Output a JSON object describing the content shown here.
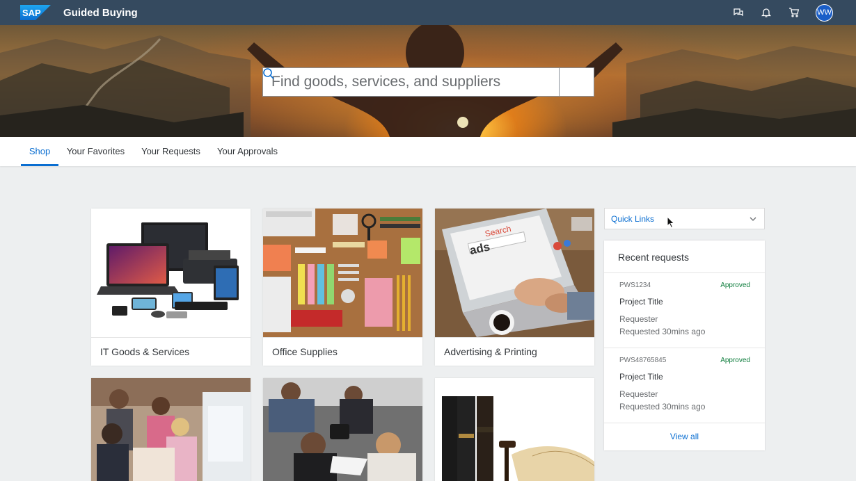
{
  "shellbar": {
    "logo_text": "SAP",
    "title": "Guided Buying",
    "avatar_initials": "WW",
    "icons": [
      "chat-icon",
      "bell-icon",
      "cart-icon"
    ]
  },
  "hero": {
    "search_placeholder": "Find goods, services, and suppliers"
  },
  "tabs": [
    {
      "label": "Shop",
      "active": true
    },
    {
      "label": "Your Favorites",
      "active": false
    },
    {
      "label": "Your Requests",
      "active": false
    },
    {
      "label": "Your Approvals",
      "active": false
    }
  ],
  "categories": [
    {
      "label": "IT Goods & Services"
    },
    {
      "label": "Office Supplies"
    },
    {
      "label": "Advertising & Printing"
    },
    {
      "label": ""
    },
    {
      "label": ""
    },
    {
      "label": ""
    }
  ],
  "advertising_image_text": {
    "search": "Search",
    "ads": "ads"
  },
  "quick_links": {
    "label": "Quick Links"
  },
  "recent_requests": {
    "title": "Recent requests",
    "items": [
      {
        "id": "PWS1234",
        "status": "Approved",
        "title": "Project Title",
        "requester": "Requester",
        "time": "Requested 30mins ago"
      },
      {
        "id": "PWS48765845",
        "status": "Approved",
        "title": "Project Title",
        "requester": "Requester",
        "time": "Requested 30mins ago"
      }
    ],
    "view_all": "View all"
  },
  "colors": {
    "shell": "#354a5f",
    "accent": "#0a6ed1",
    "positive": "#107e3e",
    "background": "#edeff0"
  }
}
